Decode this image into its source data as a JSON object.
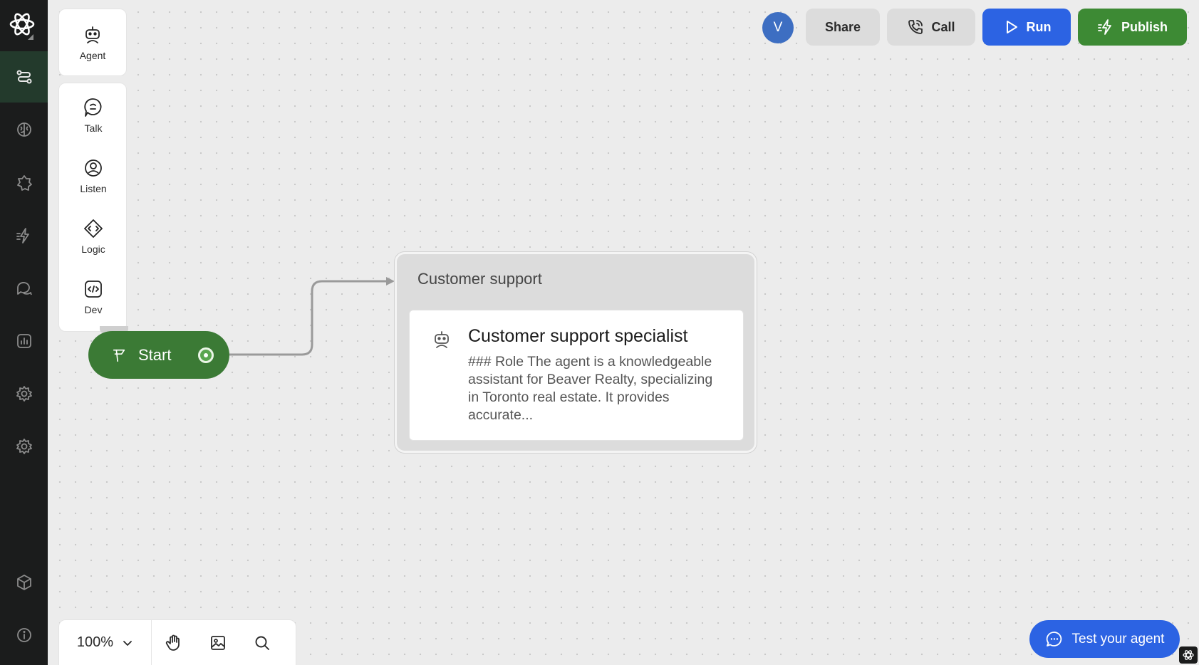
{
  "rail": {
    "items": [
      {
        "name": "flows",
        "icon": "flow-icon",
        "active": true
      },
      {
        "name": "knowledge",
        "icon": "brain-icon"
      },
      {
        "name": "integrations",
        "icon": "puzzle-icon"
      },
      {
        "name": "actions",
        "icon": "bolt-icon"
      },
      {
        "name": "conversations",
        "icon": "chat-icon"
      },
      {
        "name": "analytics",
        "icon": "chart-icon"
      },
      {
        "name": "settings",
        "icon": "gear-icon"
      },
      {
        "name": "agent-settings",
        "icon": "gear-icon"
      },
      {
        "name": "packages",
        "icon": "cube-icon"
      },
      {
        "name": "info",
        "icon": "info-icon"
      }
    ]
  },
  "palette": {
    "agent": "Agent",
    "talk": "Talk",
    "listen": "Listen",
    "logic": "Logic",
    "dev": "Dev"
  },
  "header": {
    "avatar": "V",
    "share": "Share",
    "call": "Call",
    "run": "Run",
    "publish": "Publish"
  },
  "flow": {
    "start": "Start",
    "group_title": "Customer support",
    "agent_title": "Customer support specialist",
    "agent_desc": "### Role The agent is a knowledgeable assistant for Beaver Realty, specializing in Toronto real estate. It provides accurate..."
  },
  "toolbar": {
    "zoom": "100%"
  },
  "test": {
    "label": "Test your agent"
  },
  "colors": {
    "rail_bg": "#1b1c1c",
    "run": "#2c63e3",
    "publish": "#3d8a34",
    "start": "#3b7a35",
    "avatar": "#3d6ec2"
  }
}
